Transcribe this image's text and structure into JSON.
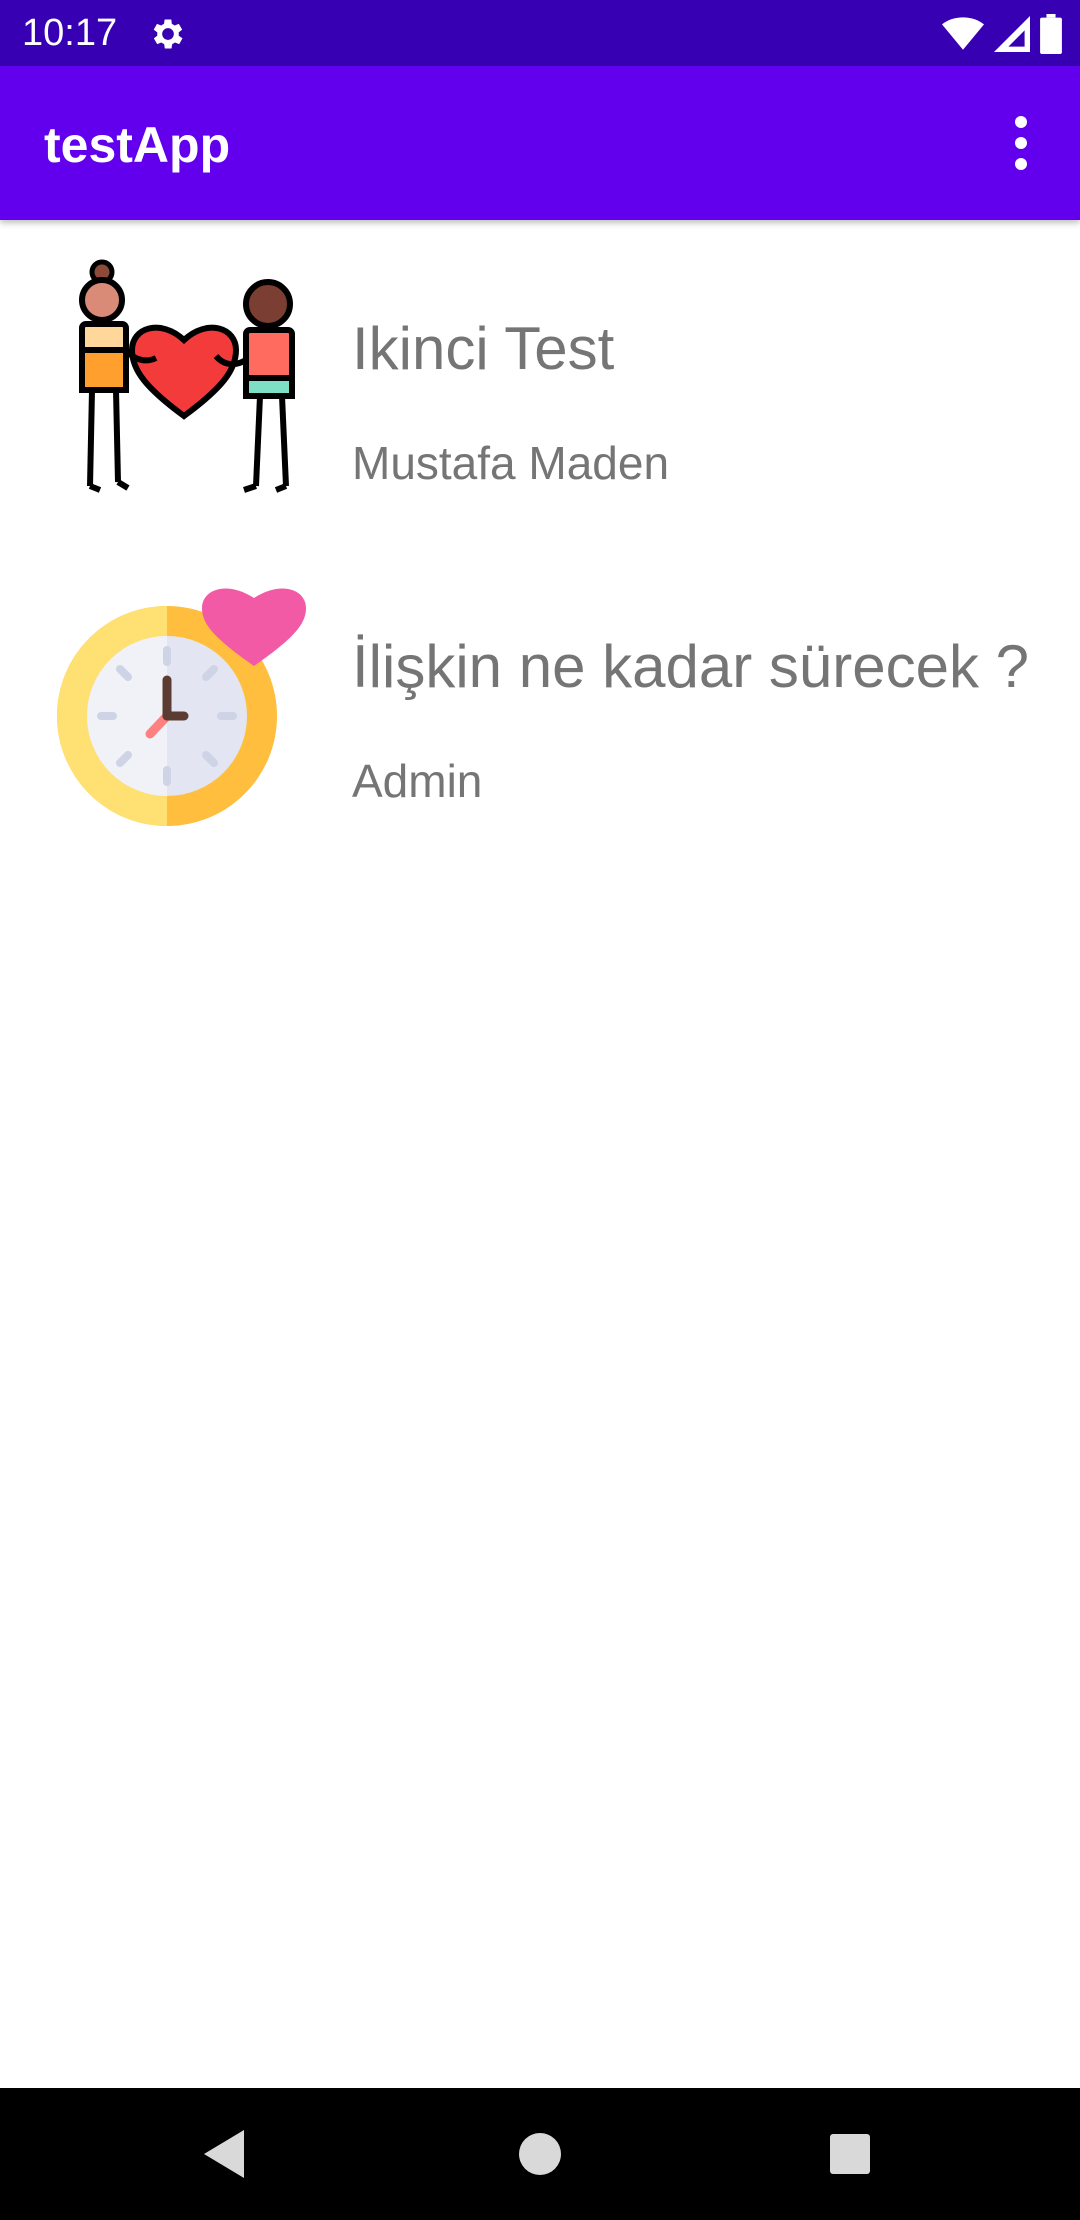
{
  "status_bar": {
    "time": "10:17",
    "icons": [
      "gear-icon",
      "wifi-icon",
      "signal-icon",
      "battery-icon"
    ],
    "background": "#3700b3"
  },
  "app_bar": {
    "title": "testApp",
    "menu_icon": "more-vert-icon",
    "background": "#6200ee"
  },
  "list": {
    "items": [
      {
        "title": "Ikinci Test",
        "subtitle": "Mustafa Maden",
        "icon": "couple-heart-icon"
      },
      {
        "title": "İlişkin ne kadar sürecek ?",
        "subtitle": "Admin",
        "icon": "clock-heart-icon"
      }
    ]
  },
  "nav_bar": {
    "buttons": [
      "back-icon",
      "home-icon",
      "recents-icon"
    ]
  }
}
